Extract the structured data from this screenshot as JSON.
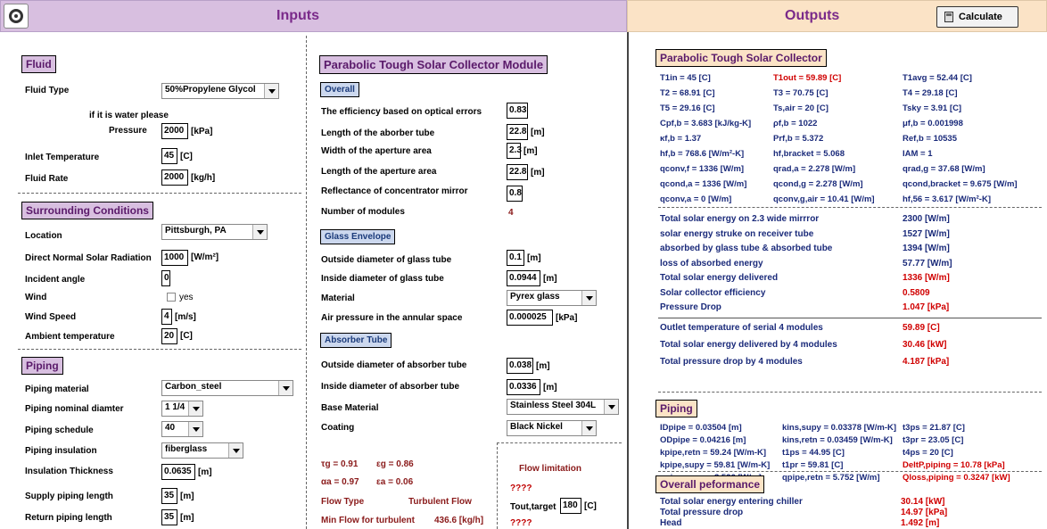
{
  "header": {
    "inputs_title": "Inputs",
    "outputs_title": "Outputs",
    "calculate_label": "Calculate"
  },
  "fluid": {
    "title": "Fluid",
    "fluid_type_label": "Fluid Type",
    "fluid_type_value": "50%Propylene Glycol",
    "water_note": "if it is water please",
    "pressure_label": "Pressure",
    "pressure_value": "2000",
    "pressure_unit": "[kPa]",
    "inlet_temp_label": "Inlet Temperature",
    "inlet_temp_value": "45",
    "inlet_temp_unit": "[C]",
    "rate_label": "Fluid Rate",
    "rate_value": "2000",
    "rate_unit": "[kg/h]"
  },
  "surrounding": {
    "title": "Surrounding Conditions",
    "location_label": "Location",
    "location_value": "Pittsburgh, PA",
    "dnr_label": "Direct Normal Solar Radiation",
    "dnr_value": "1000",
    "dnr_unit": "[W/m²]",
    "incident_label": "Incident angle",
    "incident_value": "0",
    "wind_label": "Wind",
    "wind_yes": "yes",
    "wind_speed_label": "Wind Speed",
    "wind_speed_value": "4",
    "wind_speed_unit": "[m/s]",
    "ambient_label": "Ambient temperature",
    "ambient_value": "20",
    "ambient_unit": "[C]"
  },
  "piping_in": {
    "title": "Piping",
    "material_label": "Piping material",
    "material_value": "Carbon_steel",
    "diameter_label": "Piping nominal diamter",
    "diameter_value": "1 1/4",
    "schedule_label": "Piping schedule",
    "schedule_value": "40",
    "insulation_label": "Piping insulation",
    "insulation_value": "fiberglass",
    "thickness_label": "Insulation Thickness",
    "thickness_value": "0.0635",
    "thickness_unit": "[m]",
    "supply_label": "Supply piping length",
    "supply_value": "35",
    "supply_unit": "[m]",
    "return_label": "Return piping length",
    "return_value": "35",
    "return_unit": "[m]"
  },
  "module": {
    "title": "Parabolic Tough Solar Collector Module",
    "overall_title": "Overall",
    "eff_label": "The efficiency based on optical errors",
    "eff_value": "0.83",
    "len_tube_label": "Length of the aborber tube",
    "len_tube_value": "22.8",
    "len_tube_unit": "[m]",
    "width_ap_label": "Width of the aperture area",
    "width_ap_value": "2.3",
    "width_ap_unit": "[m]",
    "len_ap_label": "Length of the aperture area",
    "len_ap_value": "22.8",
    "len_ap_unit": "[m]",
    "refl_label": "Reflectance of concentrator mirror",
    "refl_value": "0.8",
    "num_label": "Number of modules",
    "num_value": "4",
    "glass_title": "Glass Envelope",
    "g_od_label": "Outside diameter of glass tube",
    "g_od_value": "0.1",
    "g_od_unit": "[m]",
    "g_id_label": "Inside diameter of glass tube",
    "g_id_value": "0.0944",
    "g_id_unit": "[m]",
    "material_label": "Material",
    "material_value": "Pyrex glass",
    "air_label": "Air pressure in the annular space",
    "air_value": "0.000025",
    "air_unit": "[kPa]",
    "abs_title": "Absorber Tube",
    "a_od_label": "Outside diameter of absorber tube",
    "a_od_value": "0.038",
    "a_od_unit": "[m]",
    "a_id_label": "Inside diameter of absorber tube",
    "a_id_value": "0.0336",
    "a_id_unit": "[m]",
    "base_label": "Base Material",
    "base_value": "Stainless Steel 304L",
    "coating_label": "Coating",
    "coating_value": "Black Nickel",
    "tau_g": "τg = 0.91",
    "eps_g": "εg = 0.86",
    "alpha_a": "αa = 0.97",
    "eps_a": "εa = 0.06",
    "flow_type_label": "Flow Type",
    "flow_type_value": "Turbulent Flow",
    "min_flow_label": "Min Flow for turbulent",
    "min_flow_value": "436.6 [kg/h]",
    "flow_limit_label": "Flow limitation",
    "q1": "????",
    "tout_label": "Tout,target",
    "tout_value": "180",
    "tout_unit": "[C]",
    "q2": "????"
  },
  "ptc_out": {
    "title": "Parabolic Tough Solar Collector",
    "c1": [
      "T1in = 45 [C]",
      "T2 = 68.91 [C]",
      "T5 = 29.16 [C]",
      "Cpf,b = 3.683 [kJ/kg-K]",
      "κf,b = 1.37",
      "hf,b = 768.6 [W/m²-K]",
      "qconv,f = 1336 [W/m]",
      "qcond,a = 1336 [W/m]",
      "qconv,a = 0 [W/m]"
    ],
    "c2": [
      "T1out = 59.89 [C]",
      "T3 = 70.75 [C]",
      "Ts,air = 20 [C]",
      "ρf,b = 1022",
      "Prf,b = 5.372",
      "hf,bracket = 5.068",
      "qrad,a = 2.278 [W/m]",
      "qcond,g = 2.278 [W/m]",
      "qconv,g,air = 10.41 [W/m]"
    ],
    "c3": [
      "T1avg = 52.44 [C]",
      "T4 = 29.18 [C]",
      "Tsky = 3.91 [C]",
      "μf,b = 0.001998",
      "Ref,b = 10535",
      "IAM = 1",
      "qrad,g = 37.68 [W/m]",
      "qcond,bracket = 9.675 [W/m]",
      "hf,56 = 3.617 [W/m²-K]"
    ]
  },
  "energy": {
    "rows": [
      {
        "label": "Total solar energy on 2.3 wide mirrror",
        "value": "2300 [W/m]",
        "red": false
      },
      {
        "label": "solar energy struke on receiver tube",
        "value": "1527 [W/m]",
        "red": false
      },
      {
        "label": "absorbed by glass tube & absorbed tube",
        "value": "1394 [W/m]",
        "red": false
      },
      {
        "label": "loss of absorbed energy",
        "value": "57.77 [W/m]",
        "red": false
      },
      {
        "label": "Total solar energy delivered",
        "value": "1336 [W/m]",
        "red": true
      },
      {
        "label": "Solar collector efficiency",
        "value": "0.5809",
        "red": true
      },
      {
        "label": "Pressure Drop",
        "value": "1.047 [kPa]",
        "red": true
      }
    ],
    "serial_rows": [
      {
        "label": "Outlet temperature of serial  4  modules",
        "value": "59.89 [C]"
      },
      {
        "label": "Total solar energy delivered by 4 modules",
        "value": "30.46 [kW]"
      },
      {
        "label": "Total pressure drop by 4 modules",
        "value": "4.187 [kPa]"
      }
    ]
  },
  "piping_out": {
    "title": "Piping",
    "c1": [
      "IDpipe = 0.03504 [m]",
      "ODpipe = 0.04216 [m]",
      "kpipe,retn = 59.24 [W/m-K]",
      "kpipe,supy = 59.81 [W/m-K]",
      "qpipe,supy = 3.526 [W/m]"
    ],
    "c2": [
      "kins,supy = 0.03378 [W/m-K]",
      "kins,retn = 0.03459 [W/m-K]",
      "t1ps = 44.95 [C]",
      "t1pr = 59.81 [C]",
      "qpipe,retn = 5.752 [W/m]"
    ],
    "c3": [
      "t3ps = 21.87 [C]",
      "t3pr = 23.05 [C]",
      "t4ps = 20 [C]",
      "DeltP,piping = 10.78 [kPa]",
      "Qloss,piping = 0.3247 [kW]"
    ]
  },
  "overall": {
    "title": "Overall peformance",
    "rows": [
      {
        "label": "Total solar energy entering chiller",
        "value": "30.14 [kW]"
      },
      {
        "label": "Total pressure drop",
        "value": "14.97 [kPa]"
      },
      {
        "label": "Head",
        "value": "1.492 [m]"
      }
    ]
  }
}
